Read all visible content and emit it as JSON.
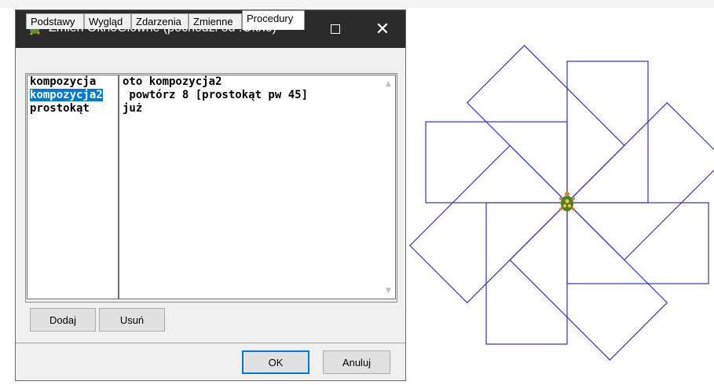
{
  "window": {
    "title": "Zmień OknoGłówne (pochodzi od .Okno)",
    "icon": "turtle-app-icon",
    "controls": {
      "minimize": "minimize-icon",
      "maximize": "maximize-icon",
      "close": "✕"
    }
  },
  "tabs": [
    {
      "label": "Podstawy",
      "active": false
    },
    {
      "label": "Wygląd",
      "active": false
    },
    {
      "label": "Zdarzenia",
      "active": false
    },
    {
      "label": "Zmienne",
      "active": false
    },
    {
      "label": "Procedury",
      "active": true
    }
  ],
  "procedures": {
    "items": [
      "kompozycja",
      "kompozycja2",
      "prostokąt"
    ],
    "selected_index": 1
  },
  "editor": {
    "lines": [
      "oto kompozycja2",
      " powtórz 8 [prostokąt pw 45]",
      "już"
    ]
  },
  "buttons": {
    "add": "Dodaj",
    "remove": "Usuń",
    "ok": "OK",
    "cancel": "Anuluj"
  },
  "canvas": {
    "stroke_color": "#3333cc",
    "repeat": 8,
    "turn_degrees": 45,
    "turtle_icon": "turtle-icon"
  }
}
